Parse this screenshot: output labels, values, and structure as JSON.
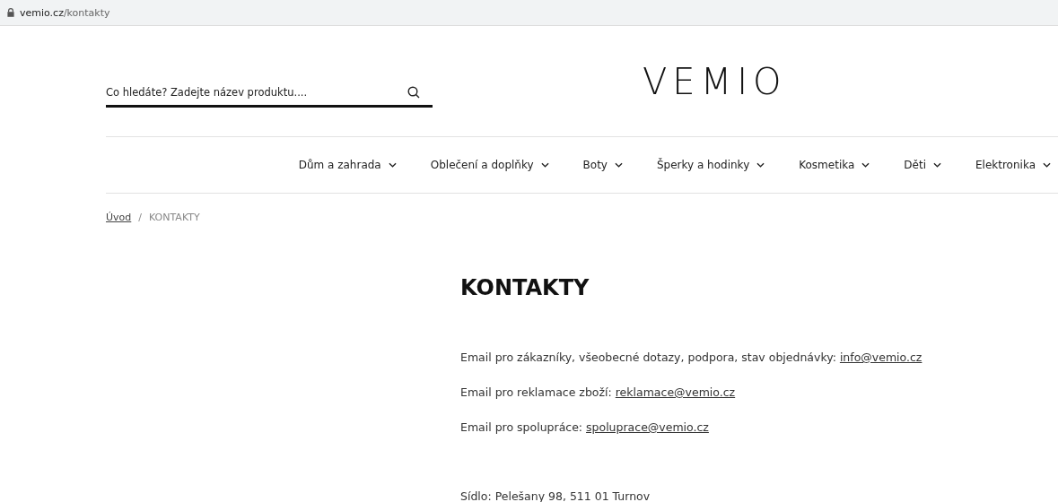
{
  "address_bar": {
    "domain": "vemio.cz",
    "path": "/kontakty"
  },
  "search": {
    "placeholder": "Co hledáte? Zadejte název produktu...."
  },
  "logo": "VEMIO",
  "nav": [
    {
      "label": "Dům a zahrada"
    },
    {
      "label": "Oblečení a doplňky"
    },
    {
      "label": "Boty"
    },
    {
      "label": "Šperky a hodinky"
    },
    {
      "label": "Kosmetika"
    },
    {
      "label": "Děti"
    },
    {
      "label": "Elektronika"
    }
  ],
  "breadcrumb": [
    {
      "label": "Úvod",
      "kind": "link"
    },
    {
      "label": "/",
      "kind": "separator"
    },
    {
      "label": "KONTAKTY",
      "kind": "current"
    }
  ],
  "heading": "KONTAKTY",
  "contacts": [
    {
      "text": "Email pro zákazníky, všeobecné dotazy, podpora, stav objednávky:",
      "email": "info@vemio.cz"
    },
    {
      "text": "Email pro reklamace zboží:",
      "email": "reklamace@vemio.cz"
    },
    {
      "text": "Email pro spolupráce:",
      "email": "spoluprace@vemio.cz"
    }
  ],
  "address": "Sídlo: Pelešany 98, 511 01 Turnov"
}
